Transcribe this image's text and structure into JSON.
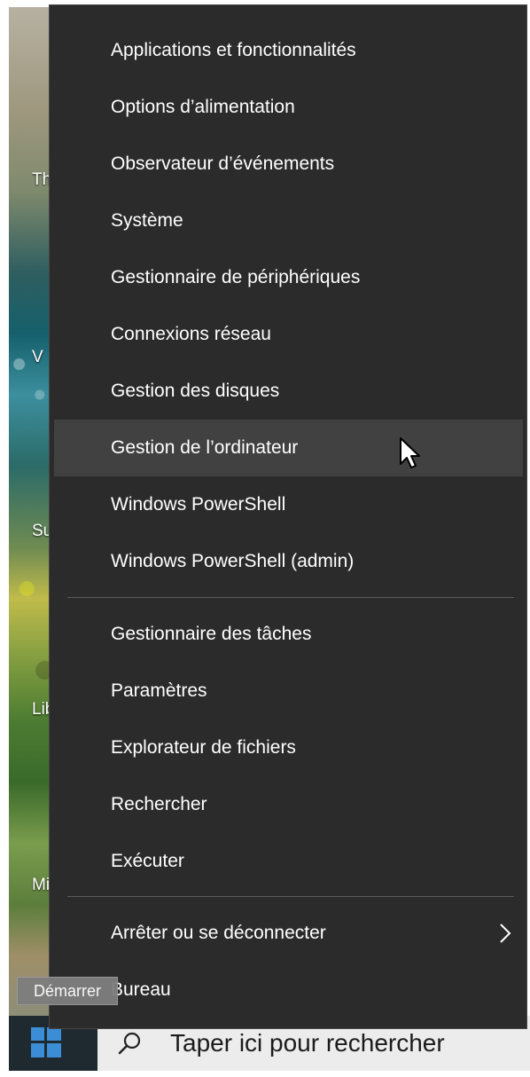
{
  "desktop": {
    "labels": [
      {
        "text": "Th"
      },
      {
        "text": "V"
      },
      {
        "text": "Su"
      },
      {
        "text": "Lib"
      },
      {
        "text": "Mi"
      }
    ]
  },
  "menu": {
    "group1": [
      {
        "label": "Applications et fonctionnalités"
      },
      {
        "label": "Options d’alimentation"
      },
      {
        "label": "Observateur d’événements"
      },
      {
        "label": "Système"
      },
      {
        "label": "Gestionnaire de périphériques"
      },
      {
        "label": "Connexions réseau"
      },
      {
        "label": "Gestion des disques"
      },
      {
        "label": "Gestion de l’ordinateur"
      },
      {
        "label": "Windows PowerShell"
      },
      {
        "label": "Windows PowerShell (admin)"
      }
    ],
    "group2": [
      {
        "label": "Gestionnaire des tâches"
      },
      {
        "label": "Paramètres"
      },
      {
        "label": "Explorateur de fichiers"
      },
      {
        "label": "Rechercher"
      },
      {
        "label": "Exécuter"
      }
    ],
    "group3": [
      {
        "label": "Arrêter ou se déconnecter"
      },
      {
        "label": "Bureau"
      }
    ],
    "hovered_item": "Gestion de l’ordinateur"
  },
  "taskbar": {
    "tooltip": "Démarrer",
    "search_placeholder": "Taper ici pour rechercher",
    "start_icon": "windows-logo-icon",
    "search_icon": "magnifier-icon"
  },
  "colors": {
    "menu_background": "#2b2b2b",
    "menu_hover": "#414141",
    "menu_text": "#ffffff",
    "separator": "#5b5b5b",
    "windows_logo": "#3b8dd6"
  }
}
